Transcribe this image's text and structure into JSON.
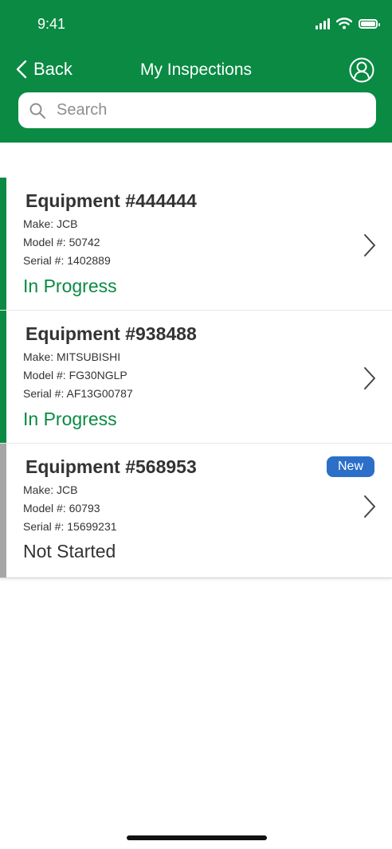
{
  "status_bar": {
    "time": "9:41"
  },
  "nav": {
    "back_label": "Back",
    "title": "My Inspections"
  },
  "search": {
    "placeholder": "Search",
    "value": ""
  },
  "colors": {
    "brand": "#0a8a43",
    "in_progress": "#0a8a43",
    "not_started": "#a6a6a6",
    "badge": "#2b6fc9"
  },
  "inspections": [
    {
      "title": "Equipment #444444",
      "make": "Make: JCB",
      "model": "Model #: 50742",
      "serial": "Serial #: 1402889",
      "status": "In Progress"
    },
    {
      "title": "Equipment #938488",
      "make": "Make: MITSUBISHI",
      "model": "Model #: FG30NGLP",
      "serial": "Serial #: AF13G00787",
      "status": "In Progress"
    },
    {
      "title": "Equipment #568953",
      "make": "Make: JCB",
      "model": "Model #: 60793",
      "serial": "Serial #: 15699231",
      "status": "Not Started",
      "badge": "New"
    }
  ],
  "icons": {
    "back": "chevron-left-icon",
    "profile": "user-circle-icon",
    "search": "search-icon",
    "row": "chevron-right-icon"
  }
}
